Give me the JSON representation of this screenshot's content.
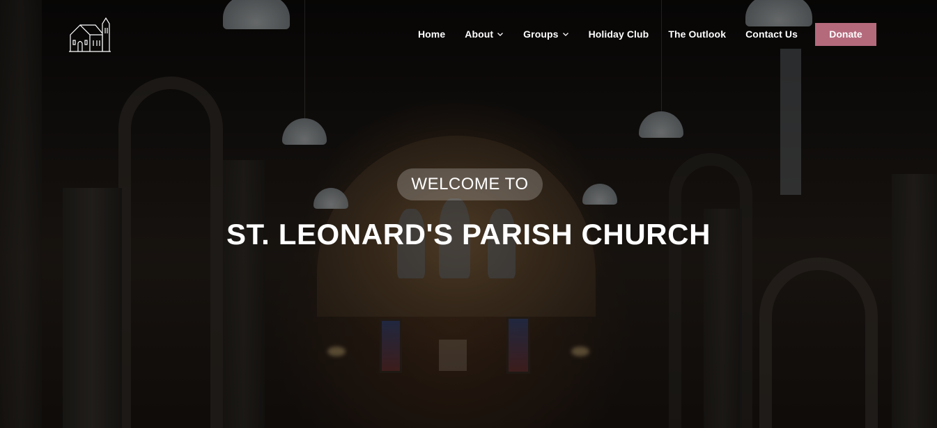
{
  "site": {
    "logo_icon": "church-icon"
  },
  "nav": {
    "items": [
      {
        "label": "Home",
        "dropdown": false
      },
      {
        "label": "About",
        "dropdown": true
      },
      {
        "label": "Groups",
        "dropdown": true
      },
      {
        "label": "Holiday Club",
        "dropdown": false
      },
      {
        "label": "The Outlook",
        "dropdown": false
      },
      {
        "label": "Contact Us",
        "dropdown": false
      }
    ],
    "donate_label": "Donate"
  },
  "hero": {
    "welcome": "WELCOME TO",
    "title": "ST. LEONARD'S PARISH CHURCH"
  },
  "colors": {
    "donate_bg": "#b56a7c",
    "text": "#ffffff"
  }
}
